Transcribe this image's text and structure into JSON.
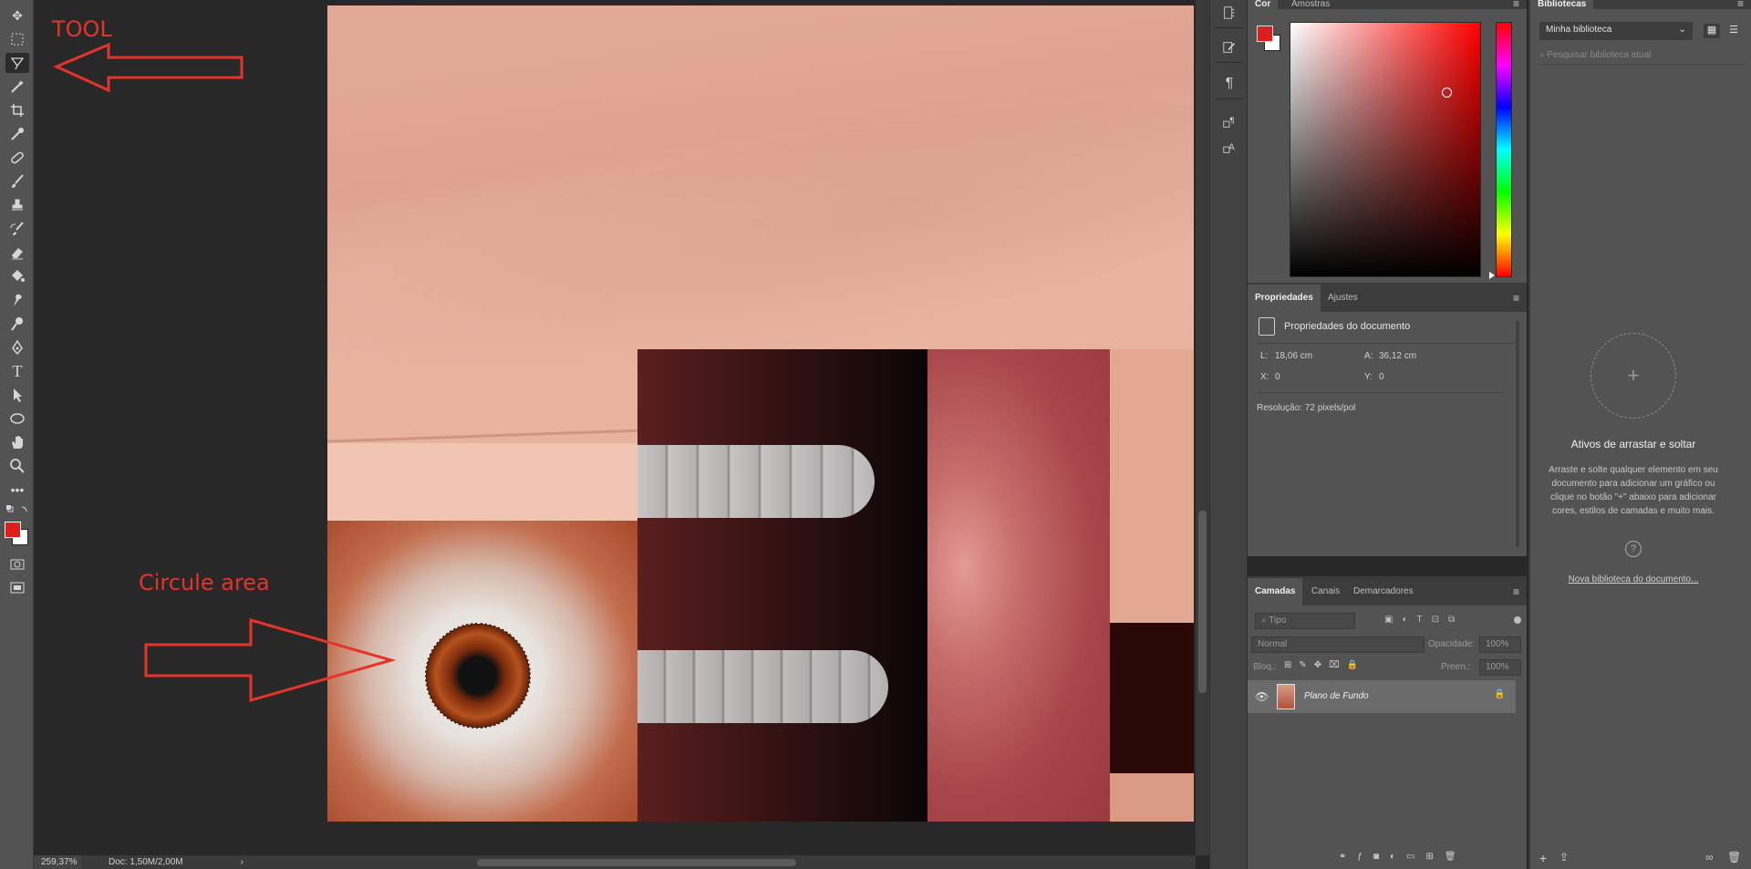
{
  "annotations": {
    "tool_label": "TOOL",
    "circle_label": "Circule area"
  },
  "status": {
    "zoom": "259,37%",
    "doc_size": "Doc: 1,50M/2,00M"
  },
  "color_panel": {
    "tabs": [
      "Cor",
      "Amostras"
    ],
    "foreground_color": "#dc1e1e",
    "background_color": "#ffffff"
  },
  "properties_panel": {
    "tabs": [
      "Propriedades",
      "Ajustes"
    ],
    "header": "Propriedades do documento",
    "width_label": "L:",
    "width_value": "18,06 cm",
    "height_label": "A:",
    "height_value": "36,12 cm",
    "x_label": "X:",
    "x_value": "0",
    "y_label": "Y:",
    "y_value": "0",
    "resolution": "Resolução: 72 pixels/pol"
  },
  "layers_panel": {
    "tabs": [
      "Camadas",
      "Canais",
      "Demarcadores"
    ],
    "filter_placeholder": "Tipo",
    "blend_mode": "Normal",
    "opacity_label": "Opacidade:",
    "opacity_value": "100%",
    "lock_label": "Bloq.:",
    "fill_label": "Preen.:",
    "fill_value": "100%",
    "layers": [
      {
        "name": "Plano de Fundo",
        "visible": true,
        "locked": true
      }
    ]
  },
  "libraries_panel": {
    "tab": "Bibliotecas",
    "library_name": "Minha biblioteca",
    "search_placeholder": "Pesquisar biblioteca atual",
    "empty_title": "Ativos de arrastar e soltar",
    "empty_description": "Arraste e solte qualquer elemento em seu documento para adicionar um gráfico ou clique no botão \"+\" abaixo para adicionar cores, estilos de camadas e muito mais.",
    "new_library_link": "Nova biblioteca do documento..."
  }
}
